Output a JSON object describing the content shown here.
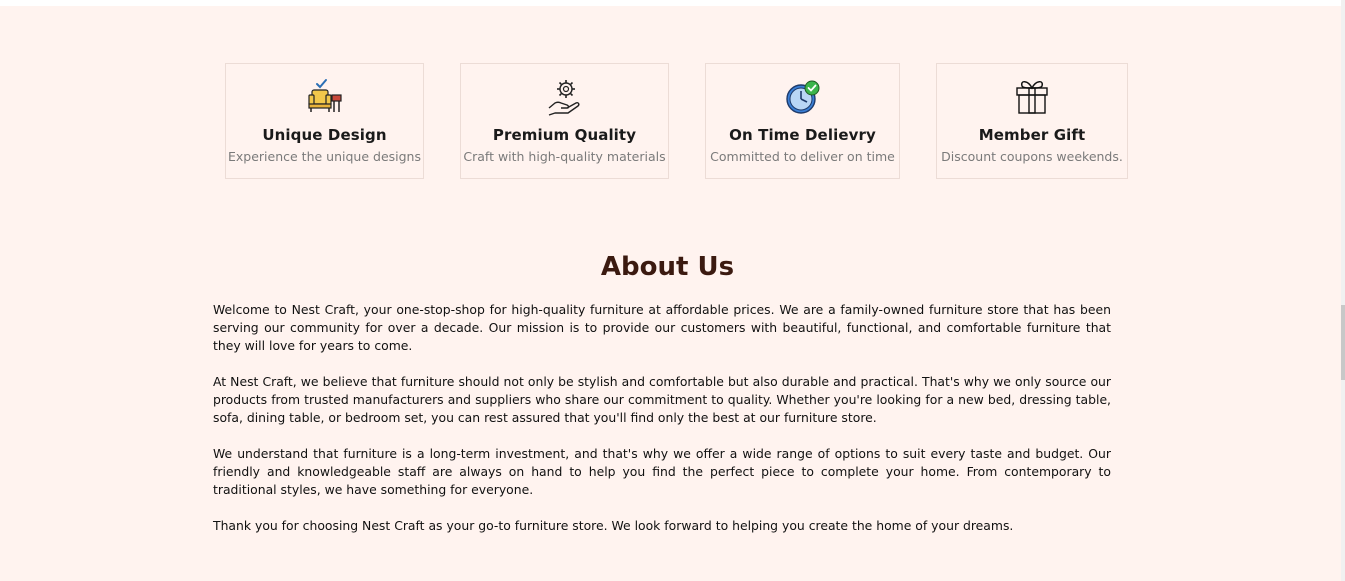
{
  "features": [
    {
      "title": "Unique Design",
      "subtitle": "Experience the unique designs",
      "icon": "chair-design-icon"
    },
    {
      "title": "Premium Quality",
      "subtitle": "Craft with high-quality materials",
      "icon": "hand-gear-quality-icon"
    },
    {
      "title": "On Time Delievry",
      "subtitle": "Committed to deliver on time",
      "icon": "clock-check-icon"
    },
    {
      "title": "Member Gift",
      "subtitle": "Discount coupons weekends.",
      "icon": "gift-box-icon"
    }
  ],
  "about": {
    "title": "About Us",
    "paragraphs": [
      "Welcome to Nest Craft, your one-stop-shop for high-quality furniture at affordable prices. We are a family-owned furniture store that has been serving our community for over a decade. Our mission is to provide our customers with beautiful, functional, and comfortable furniture that they will love for years to come.",
      "At Nest Craft, we believe that furniture should not only be stylish and comfortable but also durable and practical. That's why we only source our products from trusted manufacturers and suppliers who share our commitment to quality. Whether you're looking for a new bed, dressing table, sofa, dining table, or bedroom set, you can rest assured that you'll find only the best at our furniture store.",
      "We understand that furniture is a long-term investment, and that's why we offer a wide range of options to suit every taste and budget. Our friendly and knowledgeable staff are always on hand to help you find the perfect piece to complete your home. From contemporary to traditional styles, we have something for everyone.",
      "Thank you for choosing Nest Craft as your go-to furniture store. We look forward to helping you create the home of your dreams."
    ]
  },
  "colors": {
    "background": "#fff3ef",
    "heading": "#3b1a10",
    "card_border": "#ecdcd6",
    "subtitle": "#7a7a7a"
  }
}
